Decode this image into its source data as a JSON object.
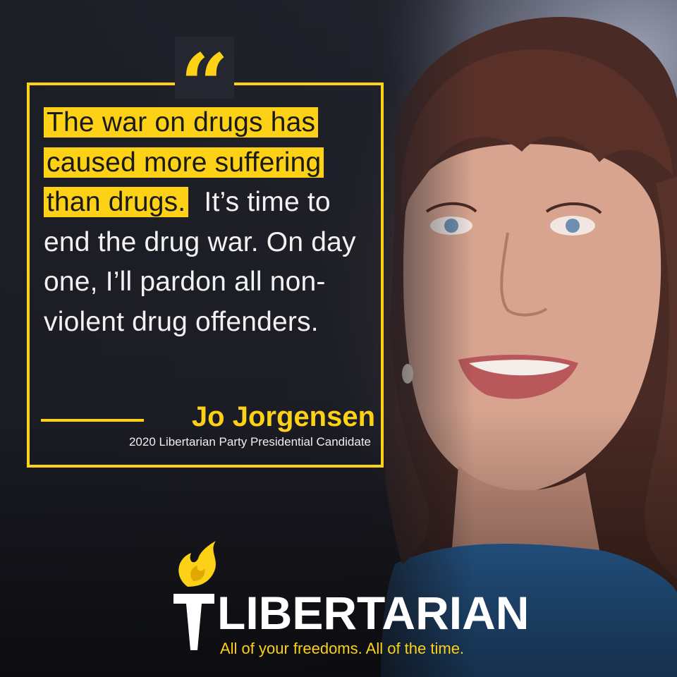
{
  "quote": {
    "highlighted_lines": [
      "The war on drugs has",
      "caused more suffering",
      "than drugs."
    ],
    "body": "It’s time to end the drug war. On day one, I’ll pardon all non-violent drug offenders."
  },
  "quote_mark": "“",
  "attribution": {
    "name": "Jo Jorgensen",
    "title": "2020 Libertarian Party Presidential Candidate"
  },
  "logo": {
    "wordmark": "LIBERTARIAN",
    "tagline": "All of your freedoms.  All of the time.",
    "icon": "torch-icon"
  },
  "colors": {
    "accent": "#fcd116",
    "text_light": "#f2f2f2",
    "background_dark": "#1a1c24"
  }
}
